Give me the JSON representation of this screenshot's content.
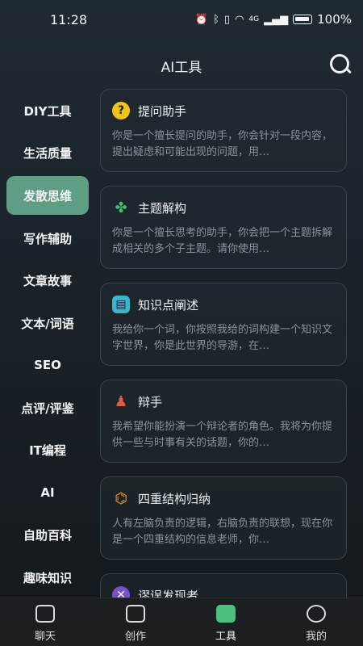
{
  "status": {
    "time": "11:28",
    "network": "4G",
    "battery": "100%"
  },
  "header": {
    "title": "AI工具"
  },
  "sidebar": {
    "items": [
      {
        "label": "DIY工具"
      },
      {
        "label": "生活质量"
      },
      {
        "label": "发散思维",
        "active": true
      },
      {
        "label": "写作辅助"
      },
      {
        "label": "文章故事"
      },
      {
        "label": "文本/词语"
      },
      {
        "label": "SEO"
      },
      {
        "label": "点评/评鉴"
      },
      {
        "label": "IT编程"
      },
      {
        "label": "AI"
      },
      {
        "label": "自助百科"
      },
      {
        "label": "趣味知识"
      }
    ]
  },
  "cards": [
    {
      "icon": "question-icon",
      "title": "提问助手",
      "desc": "你是一个擅长提问的助手，你会针对一段内容，提出疑虑和可能出现的问题，用…"
    },
    {
      "icon": "clover-icon",
      "title": "主题解构",
      "desc": "你是一个擅长思考的助手，你会把一个主题拆解成相关的多个子主题。请你使用…"
    },
    {
      "icon": "book-icon",
      "title": "知识点阐述",
      "desc": "我给你一个词，你按照我给的词构建一个知识文字世界，你是此世界的导游，在…"
    },
    {
      "icon": "debate-icon",
      "title": "辩手",
      "desc": "我希望你能扮演一个辩论者的角色。我将为你提供一些与时事有关的话题，你的…"
    },
    {
      "icon": "structure-icon",
      "title": "四重结构归纳",
      "desc": "人有左脑负责的逻辑，右脑负责的联想，现在你是一个四重结构的信息老师，你…"
    },
    {
      "icon": "error-finder-icon",
      "title": "谬误发现者",
      "desc": ""
    }
  ],
  "bottom_nav": [
    {
      "label": "聊天"
    },
    {
      "label": "创作"
    },
    {
      "label": "工具",
      "active": true
    },
    {
      "label": "我的"
    }
  ]
}
